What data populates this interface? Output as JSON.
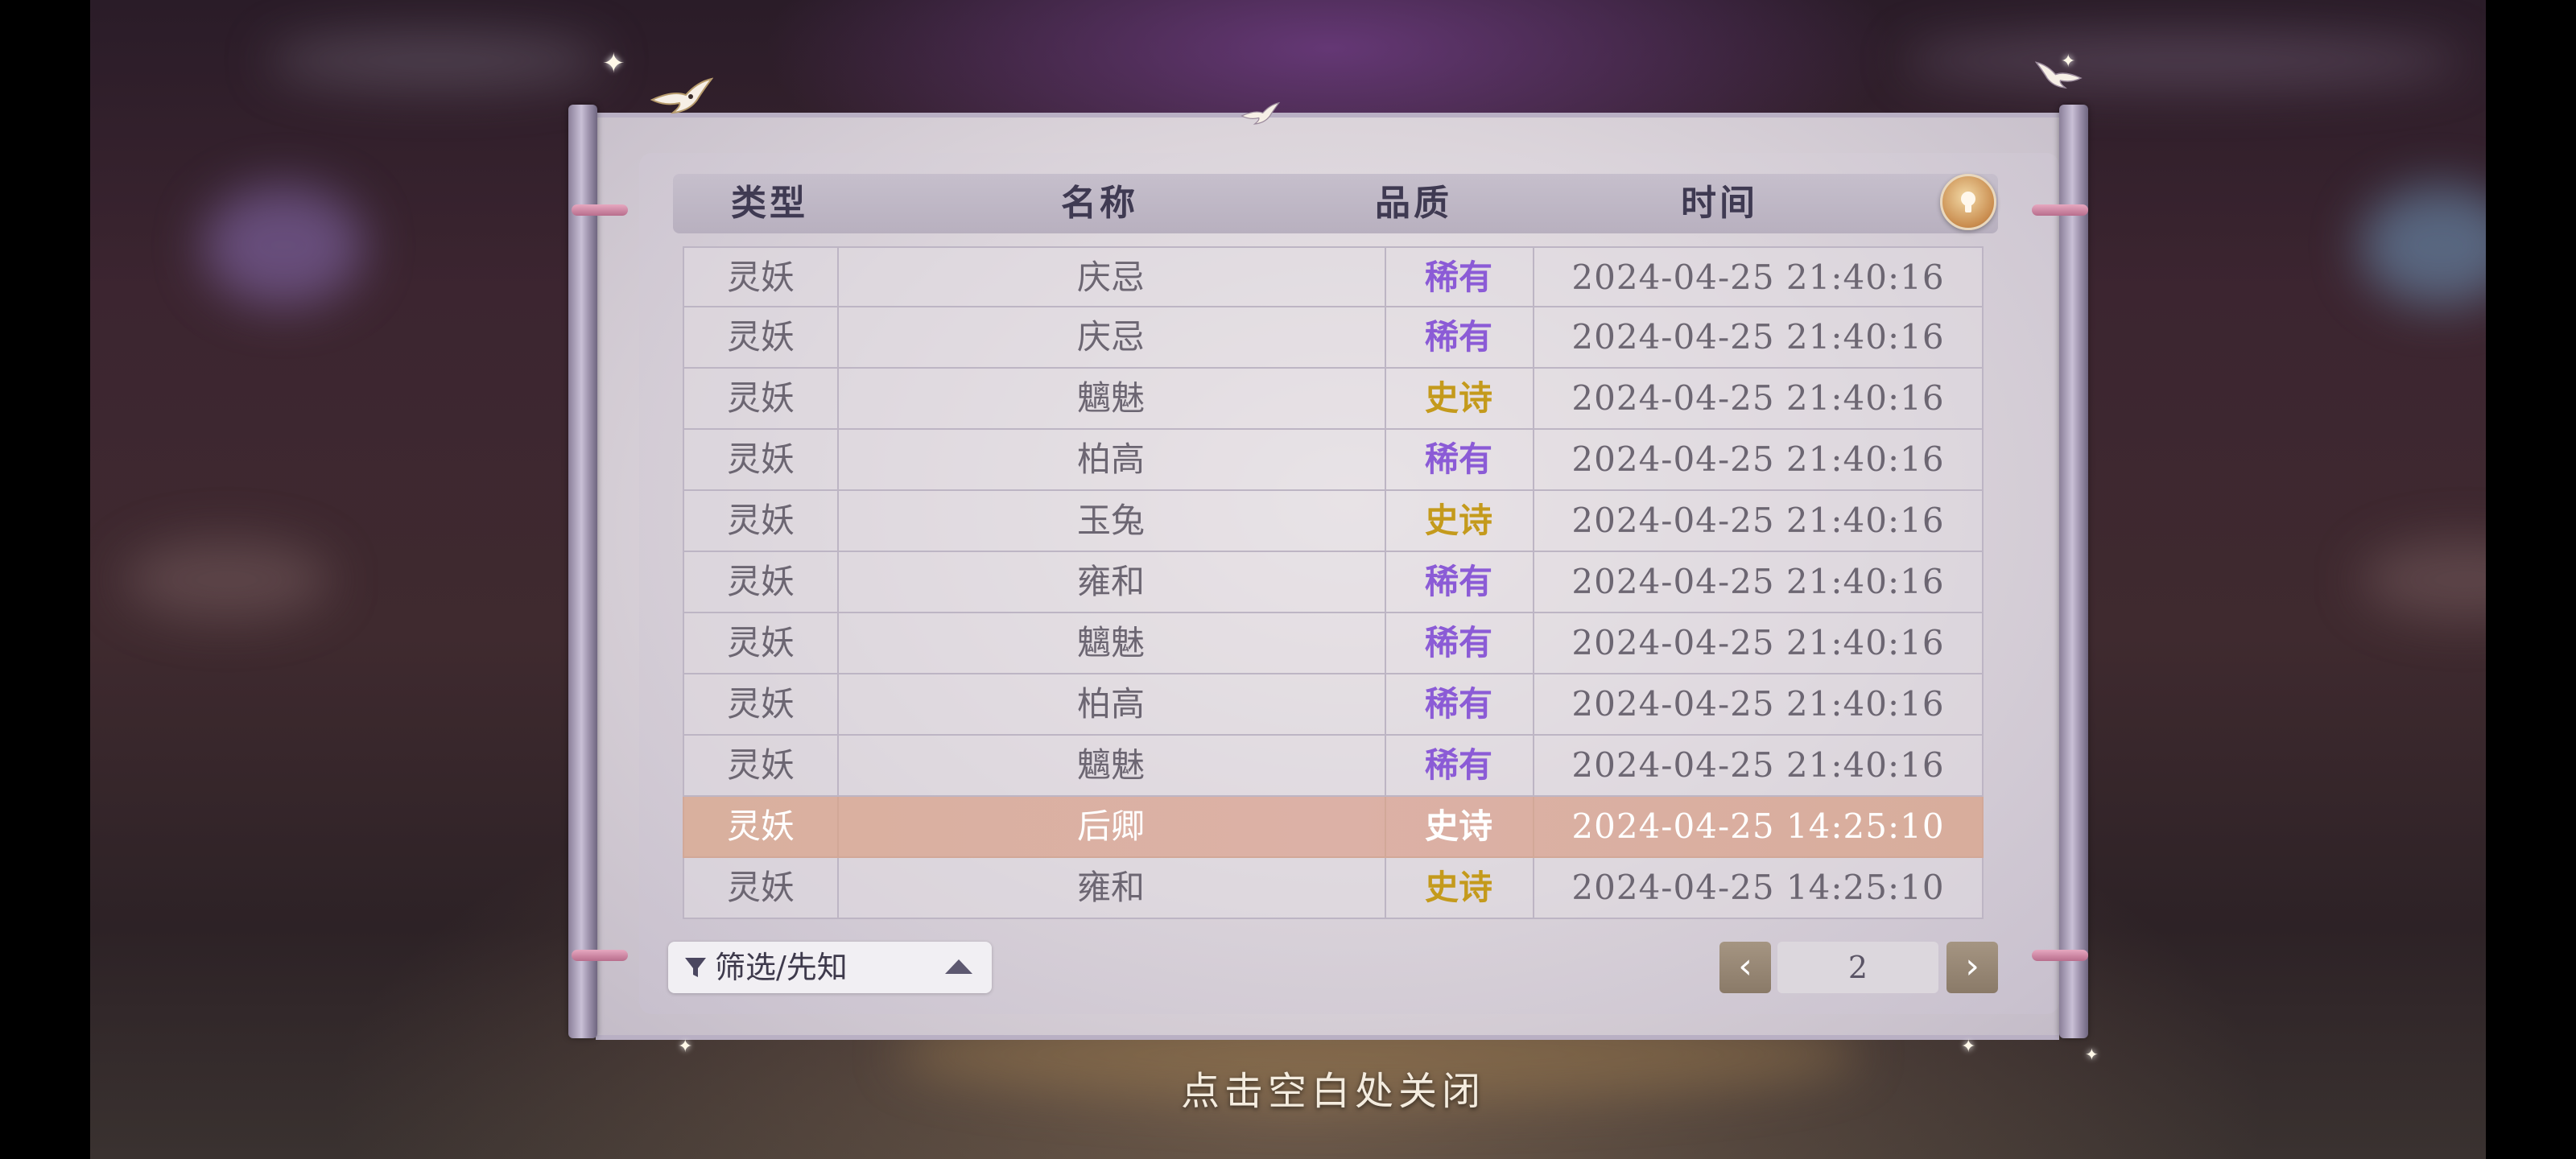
{
  "table": {
    "headers": {
      "type": "类型",
      "name": "名称",
      "quality": "品质",
      "time": "时间"
    },
    "rows": [
      {
        "type": "灵妖",
        "name": "庆忌",
        "quality": "稀有",
        "quality_color": "#8b5bd6",
        "time": "2024-04-25  21:40:16"
      },
      {
        "type": "灵妖",
        "name": "庆忌",
        "quality": "稀有",
        "quality_color": "#8b5bd6",
        "time": "2024-04-25  21:40:16"
      },
      {
        "type": "灵妖",
        "name": "魑魅",
        "quality": "史诗",
        "quality_color": "#c49a1c",
        "time": "2024-04-25  21:40:16"
      },
      {
        "type": "灵妖",
        "name": "柏高",
        "quality": "稀有",
        "quality_color": "#8b5bd6",
        "time": "2024-04-25  21:40:16"
      },
      {
        "type": "灵妖",
        "name": "玉兔",
        "quality": "史诗",
        "quality_color": "#c49a1c",
        "time": "2024-04-25  21:40:16"
      },
      {
        "type": "灵妖",
        "name": "雍和",
        "quality": "稀有",
        "quality_color": "#8b5bd6",
        "time": "2024-04-25  21:40:16"
      },
      {
        "type": "灵妖",
        "name": "魑魅",
        "quality": "稀有",
        "quality_color": "#8b5bd6",
        "time": "2024-04-25  21:40:16"
      },
      {
        "type": "灵妖",
        "name": "柏高",
        "quality": "稀有",
        "quality_color": "#8b5bd6",
        "time": "2024-04-25  21:40:16"
      },
      {
        "type": "灵妖",
        "name": "魑魅",
        "quality": "稀有",
        "quality_color": "#8b5bd6",
        "time": "2024-04-25  21:40:16"
      },
      {
        "type": "灵妖",
        "name": "后卿",
        "quality": "史诗",
        "quality_color": "#ffffff",
        "time": "2024-04-25  14:25:10",
        "selected": true
      },
      {
        "type": "灵妖",
        "name": "雍和",
        "quality": "史诗",
        "quality_color": "#c49a1c",
        "time": "2024-04-25  14:25:10"
      }
    ]
  },
  "filter": {
    "label": "筛选/先知",
    "icon": "funnel-icon"
  },
  "pagination": {
    "page": "2",
    "prev_icon": "chevron-left-icon",
    "next_icon": "chevron-right-icon"
  },
  "hint": {
    "close": "点击空白处关闭"
  },
  "info_button": {
    "icon": "lightbulb-icon"
  },
  "colors": {
    "rare": "#8b5bd6",
    "epic": "#c49a1c",
    "selected_row": "#dcb1a6"
  }
}
